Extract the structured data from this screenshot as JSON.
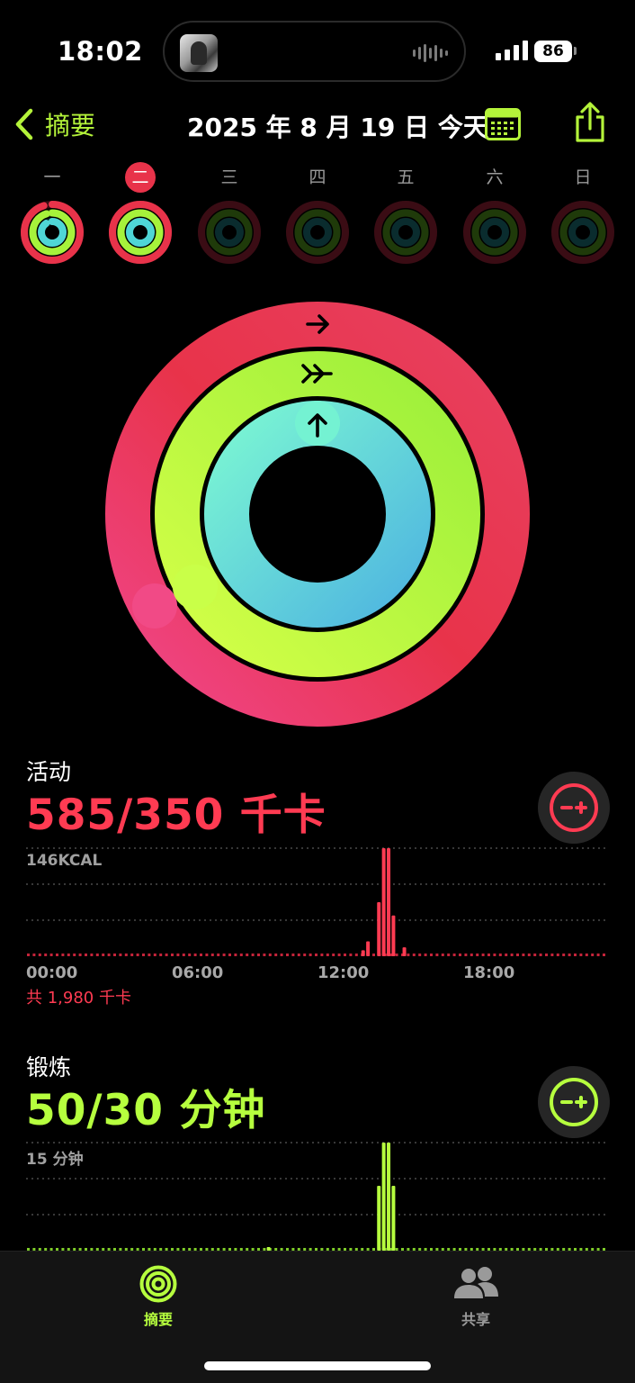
{
  "status_bar": {
    "time": "18:02",
    "battery": "86"
  },
  "nav": {
    "back_label": "摘要",
    "title": "2025 年 8 月 19 日 今天",
    "calendar_icon": "calendar-icon",
    "share_icon": "share-icon"
  },
  "week": {
    "days": [
      {
        "label": "一",
        "move": 0.95,
        "exercise": 0.95,
        "stand": 0.9,
        "active": false
      },
      {
        "label": "二",
        "move": 1.67,
        "exercise": 1.67,
        "stand": 1.0,
        "active": true
      },
      {
        "label": "三",
        "move": 0,
        "exercise": 0,
        "stand": 0,
        "active": false
      },
      {
        "label": "四",
        "move": 0,
        "exercise": 0,
        "stand": 0,
        "active": false
      },
      {
        "label": "五",
        "move": 0,
        "exercise": 0,
        "stand": 0,
        "active": false
      },
      {
        "label": "六",
        "move": 0,
        "exercise": 0,
        "stand": 0,
        "active": false
      },
      {
        "label": "日",
        "move": 0,
        "exercise": 0,
        "stand": 0,
        "active": false
      }
    ]
  },
  "rings": {
    "move_progress": 1.67,
    "exercise_progress": 1.67,
    "stand_progress": 1.0,
    "colors": {
      "move": "#e8334a",
      "exercise": "#a6f23b",
      "stand": "#4fd6d6"
    }
  },
  "move": {
    "title": "活动",
    "value": "585/350 千卡",
    "peak_label": "146KCAL",
    "x_ticks": [
      "00:00",
      "06:00",
      "12:00",
      "18:00"
    ],
    "total": "共 1,980 千卡",
    "color": "#ff3b52",
    "adjust_icon": "minus-plus-icon"
  },
  "exercise": {
    "title": "锻炼",
    "value": "50/30 分钟",
    "peak_label": "15 分钟",
    "color": "#b6ff3e",
    "adjust_icon": "minus-plus-icon"
  },
  "chart_data": [
    {
      "type": "bar",
      "title": "活动",
      "ylabel": "146KCAL",
      "x_ticks": [
        "00:00",
        "06:00",
        "12:00",
        "18:00"
      ],
      "xlim": [
        0,
        24
      ],
      "ylim": [
        0,
        146
      ],
      "x": [
        13.9,
        14.1,
        14.55,
        14.75,
        14.95,
        15.15,
        15.6
      ],
      "values": [
        8,
        20,
        73,
        146,
        146,
        55,
        12
      ]
    },
    {
      "type": "bar",
      "title": "锻炼",
      "ylabel": "15 分钟",
      "xlim": [
        0,
        24
      ],
      "ylim": [
        0,
        15
      ],
      "x": [
        10.0,
        14.55,
        14.75,
        14.95,
        15.15
      ],
      "values": [
        0.5,
        9,
        15,
        15,
        9
      ]
    }
  ],
  "tabbar": {
    "tabs": [
      {
        "label": "摘要",
        "icon": "activity-rings-icon",
        "active": true
      },
      {
        "label": "共享",
        "icon": "people-icon",
        "active": false
      }
    ]
  }
}
